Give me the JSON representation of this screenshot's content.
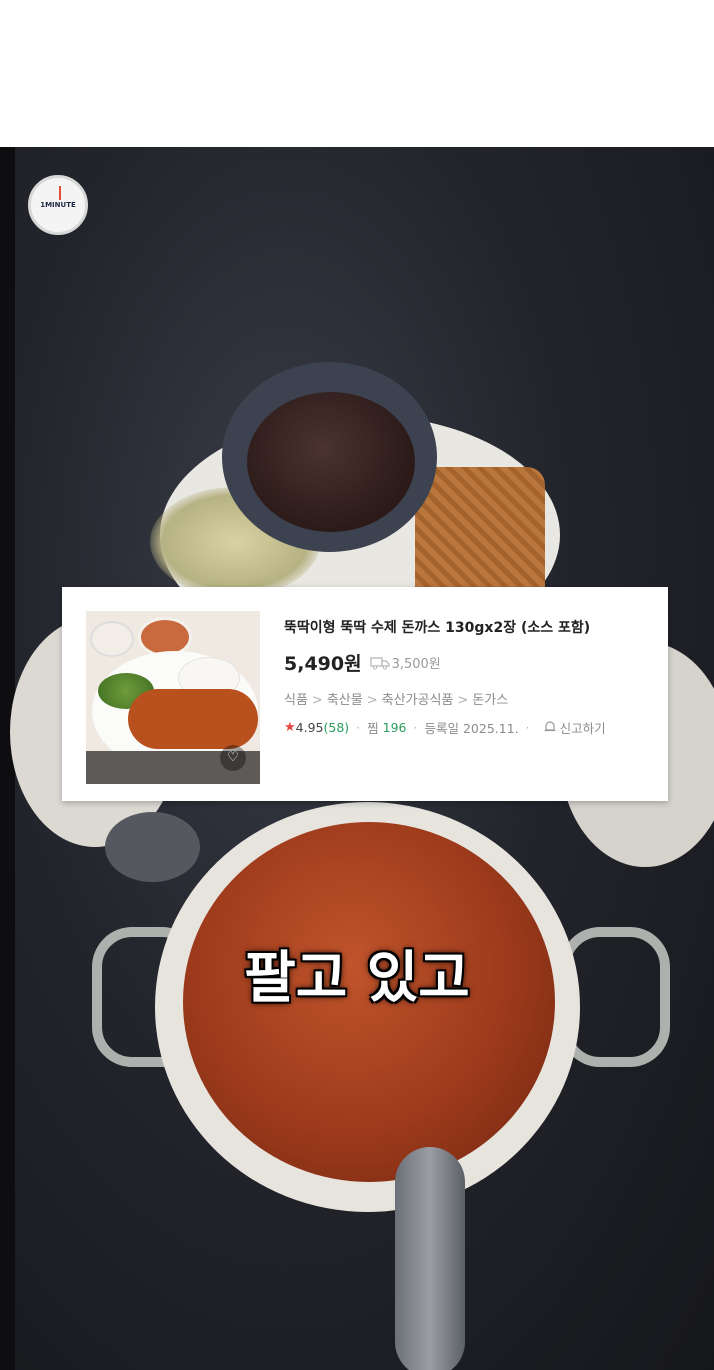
{
  "logo": {
    "text": "1MINUTE",
    "icon": "alarm-clock-icon"
  },
  "product": {
    "title": "뚝딱이형 뚝딱 수제 돈까스 130gx2장 (소스 포함)",
    "price": "5,490원",
    "shipping_icon": "truck-icon",
    "shipping_fee": "3,500원",
    "categories": [
      "식품",
      "축산물",
      "축산가공식품",
      "돈가스"
    ],
    "separator": ">",
    "rating_icon": "star-icon",
    "rating": "4.95",
    "review_count": "(58)",
    "wishlist_label": "찜",
    "wishlist_count": "196",
    "registered": "등록일 2025.11.",
    "report_icon": "bell-icon",
    "report_label": "신고하기",
    "heart_icon": "heart-icon"
  },
  "caption": "팔고 있고"
}
